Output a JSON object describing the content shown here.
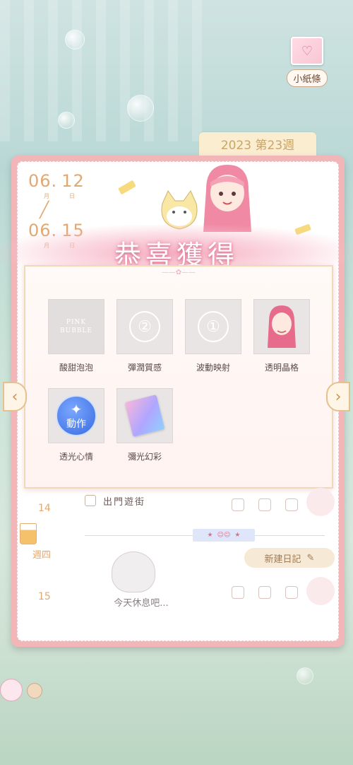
{
  "header": {
    "note_button_label": "小紙條"
  },
  "diary": {
    "week_tab": "2023 第23週",
    "dates": {
      "start": {
        "month": "06.",
        "day": "12",
        "month_unit": "月",
        "day_unit": "日"
      },
      "end": {
        "month": "06.",
        "day": "15",
        "month_unit": "月",
        "day_unit": "日"
      }
    }
  },
  "reward_popup": {
    "title": "恭喜獲得",
    "items": [
      {
        "label": "酸甜泡泡",
        "thumb_text_1": "PINK BUBBLE"
      },
      {
        "label": "彈潤質感",
        "thumb_symbol": "②"
      },
      {
        "label": "波動映射",
        "thumb_symbol": "①"
      },
      {
        "label": "透明晶格"
      },
      {
        "label": "透光心情",
        "badge_text": "動作"
      },
      {
        "label": "彌光幻彩"
      }
    ]
  },
  "schedule": {
    "row14": {
      "day": "14",
      "task": "出門遊街"
    },
    "weekday_label": "週四",
    "new_diary_label": "新建日記",
    "row15": {
      "day": "15",
      "rest_text": "今天休息吧..."
    }
  },
  "icons": {
    "left_arrow": "chevron-left-icon",
    "right_arrow": "chevron-right-icon",
    "edit": "pencil-icon"
  },
  "colors": {
    "accent_pink": "#f2b6b8",
    "date_orange": "#e2a871",
    "badge_blue": "#3a6be0"
  }
}
